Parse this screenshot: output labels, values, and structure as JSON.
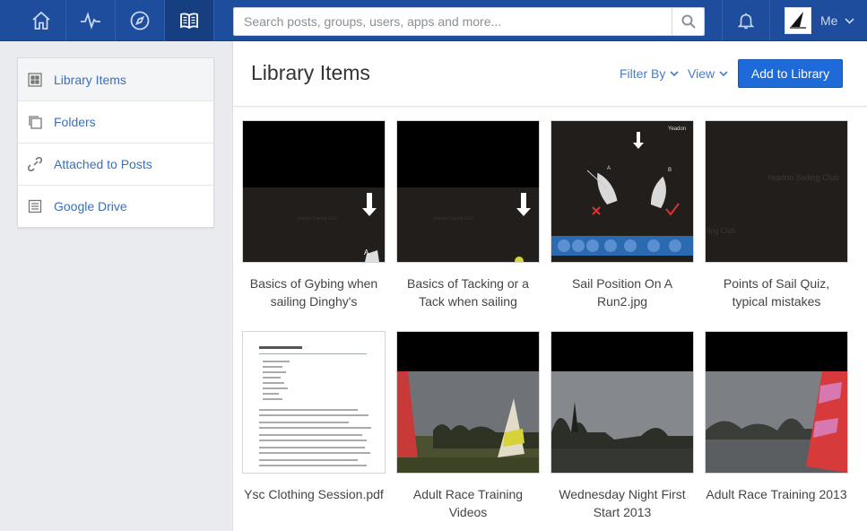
{
  "topbar": {
    "nav": [
      {
        "name": "home-icon"
      },
      {
        "name": "activity-icon"
      },
      {
        "name": "compass-icon"
      },
      {
        "name": "library-book-icon"
      }
    ],
    "search_placeholder": "Search posts, groups, users, apps and more...",
    "me_label": "Me"
  },
  "sidebar": {
    "items": [
      {
        "label": "Library Items",
        "icon": "grid-icon"
      },
      {
        "label": "Folders",
        "icon": "folders-icon"
      },
      {
        "label": "Attached to Posts",
        "icon": "link-icon"
      },
      {
        "label": "Google Drive",
        "icon": "document-icon"
      }
    ]
  },
  "main": {
    "title": "Library Items",
    "filter_label": "Filter By",
    "view_label": "View",
    "add_button": "Add to Library",
    "items": [
      {
        "label": "Basics of Gybing when sailing Dinghy's"
      },
      {
        "label": "Basics of Tacking or a Tack when sailing"
      },
      {
        "label": "Sail Position On A Run2.jpg"
      },
      {
        "label": "Points of Sail Quiz, typical mistakes"
      },
      {
        "label": "Ysc Clothing Session.pdf"
      },
      {
        "label": "Adult Race Training Videos"
      },
      {
        "label": "Wednesday Night First Start 2013"
      },
      {
        "label": "Adult Race Training 2013"
      }
    ]
  },
  "colors": {
    "topbar": "#1d4d9c",
    "accent": "#1e6ad8",
    "link": "#4a7cc6"
  }
}
